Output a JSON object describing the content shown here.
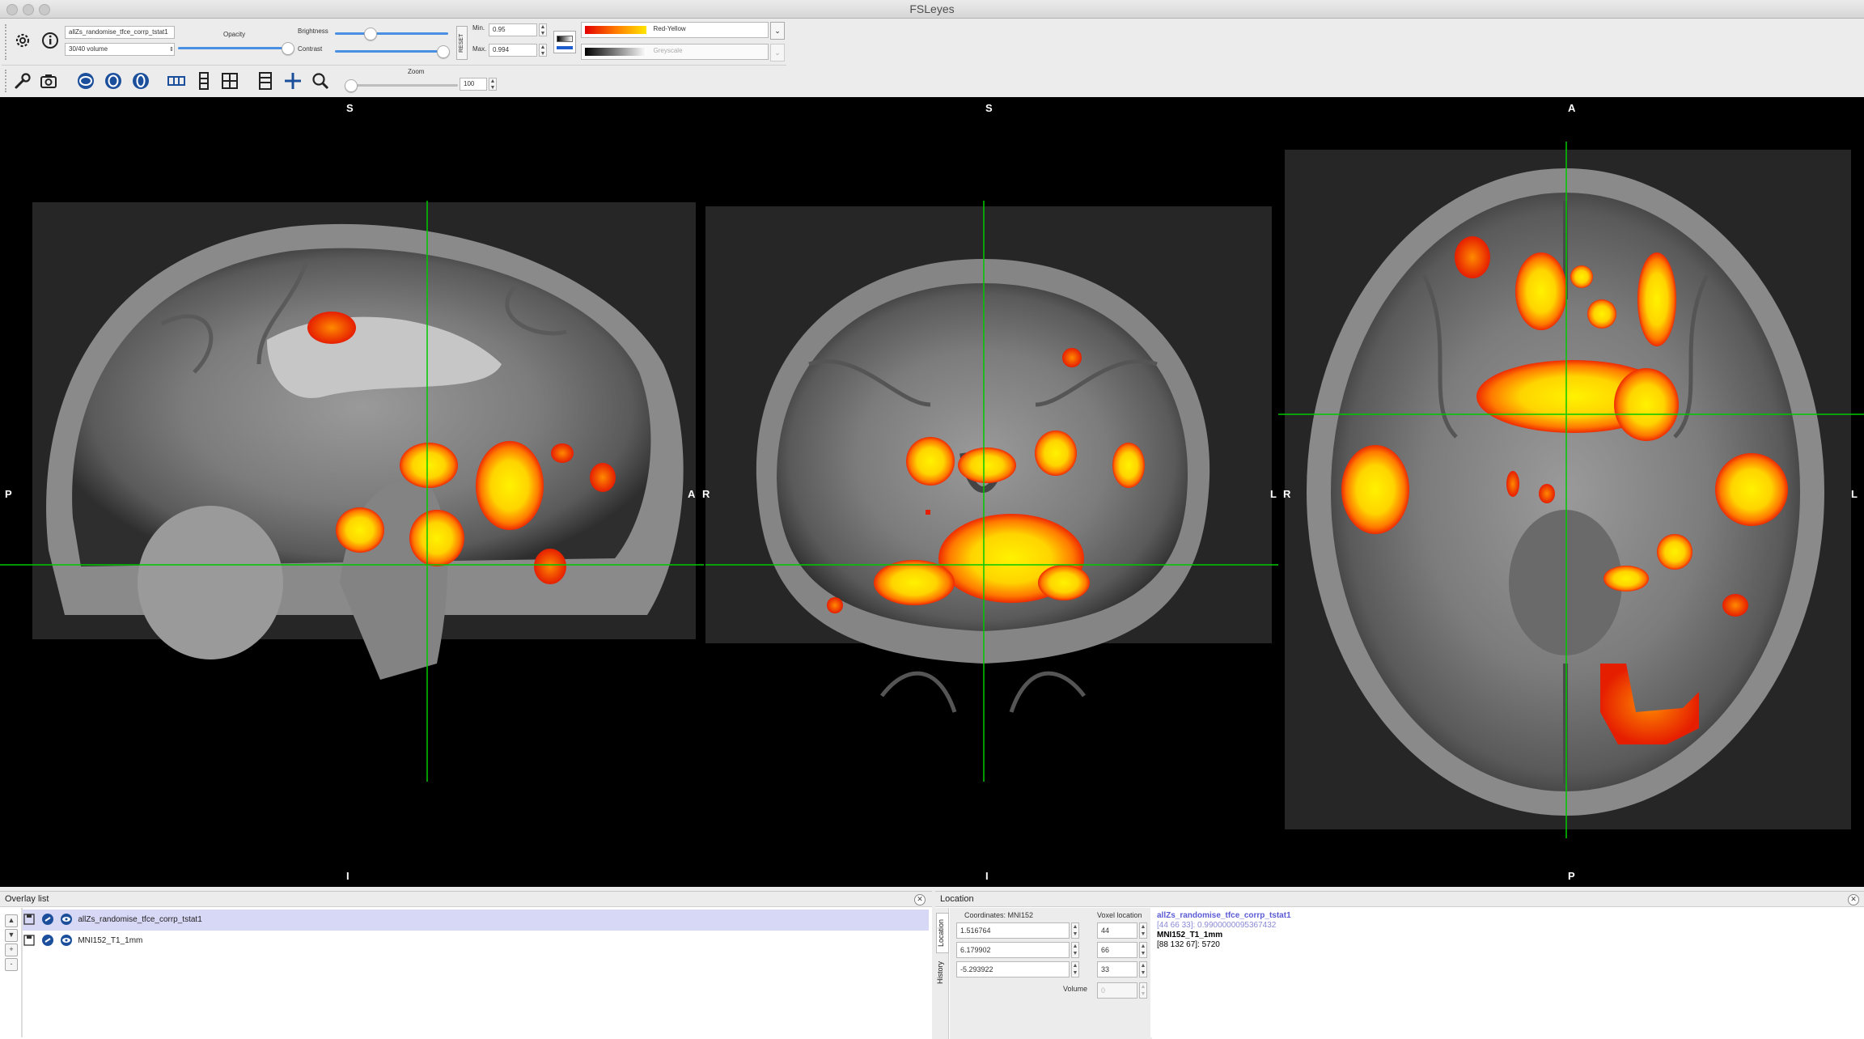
{
  "window": {
    "title": "FSLeyes"
  },
  "toolbar": {
    "overlay_name": "allZs_randomise_tfce_corrp_tstat1",
    "volume_select": "30/40 volume",
    "opacity_label": "Opacity",
    "brightness_label": "Brightness",
    "contrast_label": "Contrast",
    "reset_label": "RESET",
    "min_label": "Min.",
    "min_value": "0.95",
    "max_label": "Max.",
    "max_value": "0.994",
    "cmap_primary": "Red-Yellow",
    "cmap_secondary": "Greyscale",
    "zoom_label": "Zoom",
    "zoom_value": "100"
  },
  "views": {
    "sagittal": {
      "top": "S",
      "bottom": "I",
      "left": "P",
      "right": "A"
    },
    "coronal": {
      "top": "S",
      "bottom": "I",
      "left": "R",
      "right": "L"
    },
    "axial": {
      "top": "A",
      "bottom": "P",
      "left": "R",
      "right": "L"
    }
  },
  "overlay_list": {
    "title": "Overlay list",
    "items": [
      {
        "name": "allZs_randomise_tfce_corrp_tstat1",
        "selected": true
      },
      {
        "name": "MNI152_T1_1mm",
        "selected": false
      }
    ],
    "buttons": [
      "▲",
      "▼",
      "+",
      "-"
    ]
  },
  "location": {
    "title": "Location",
    "side_tabs": [
      "Location",
      "History"
    ],
    "coords_label": "Coordinates: MNI152",
    "coords": [
      "1.516764",
      "6.179902",
      "-5.293922"
    ],
    "voxel_label": "Voxel location",
    "voxels": [
      "44",
      "66",
      "33"
    ],
    "volume_label": "Volume",
    "volume_value": "0",
    "info": {
      "overlay_name": "allZs_randomise_tfce_corrp_tstat1",
      "overlay_value": "[44 66 33]: 0.9900000095367432",
      "base_name": "MNI152_T1_1mm",
      "base_value": "[88 132 67]: 5720"
    }
  },
  "colors": {
    "accent": "#4a90e2",
    "crosshair": "#00c800",
    "background": "#000000"
  }
}
